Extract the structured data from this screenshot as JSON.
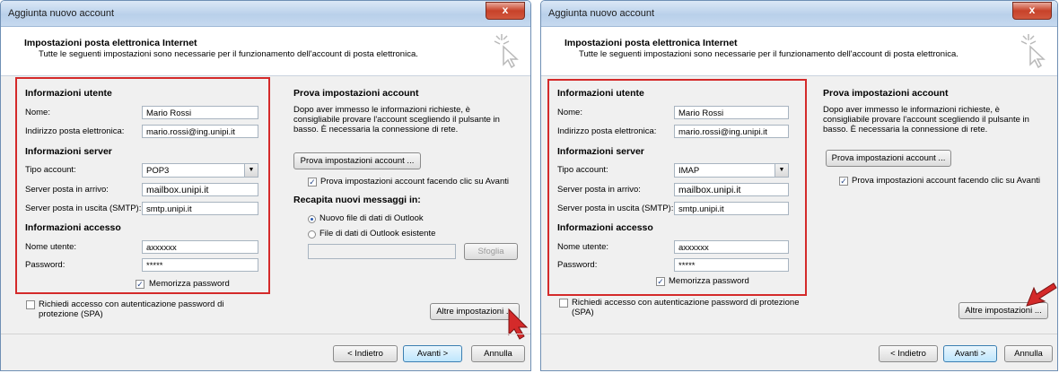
{
  "title": "Aggiunta nuovo account",
  "close_glyph": "x",
  "header_title": "Impostazioni posta elettronica Internet",
  "header_subtitle": "Tutte le seguenti impostazioni sono necessarie per il funzionamento dell'account di posta elettronica.",
  "labels": {
    "user_info": "Informazioni utente",
    "name": "Nome:",
    "email": "Indirizzo posta elettronica:",
    "server_info": "Informazioni server",
    "account_type": "Tipo account:",
    "incoming": "Server posta in arrivo:",
    "outgoing": "Server posta in uscita (SMTP):",
    "login_info": "Informazioni accesso",
    "username": "Nome utente:",
    "password": "Password:",
    "remember": "Memorizza password",
    "spa": "Richiedi accesso con autenticazione password di protezione (SPA)",
    "test_title": "Prova impostazioni account",
    "test_desc": "Dopo aver immesso le informazioni richieste, è consigliabile provare l'account scegliendo il pulsante in basso. È necessaria la connessione di rete.",
    "test_button": "Prova impostazioni account ...",
    "test_on_next": "Prova impostazioni account facendo clic su Avanti",
    "deliver_title": "Recapita nuovi messaggi in:",
    "new_file": "Nuovo file di dati di Outlook",
    "existing_file": "File di dati di Outlook esistente",
    "browse": "Sfoglia",
    "more_settings": "Altre impostazioni ...",
    "back": "< Indietro",
    "next": "Avanti >",
    "cancel": "Annulla"
  },
  "values": {
    "name": "Mario Rossi",
    "email": "mario.rossi@ing.unipi.it",
    "incoming": "mailbox.unipi.it",
    "outgoing": "smtp.unipi.it",
    "username": "axxxxxx",
    "password": "*****",
    "type_left": "POP3",
    "type_right": "IMAP"
  },
  "state": {
    "remember_checked": true,
    "spa_checked": false,
    "test_on_next_checked": true,
    "delivery_selected": "new_file"
  },
  "colors": {
    "highlight": "#d42a2a",
    "dialog_bg": "#f0f0f0",
    "title_bar": "#c6d9ef",
    "pointer": "#d42a2a"
  }
}
